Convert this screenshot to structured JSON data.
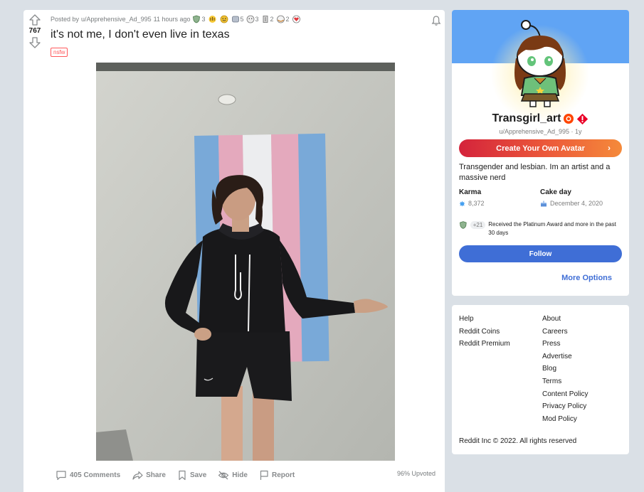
{
  "post": {
    "score": "767",
    "posted_by_prefix": "Posted by",
    "author": "u/Apprehensive_Ad_995",
    "time": "11 hours ago",
    "awards": [
      {
        "icon": "shield-award-icon",
        "count": "3"
      },
      {
        "icon": "hands-award-icon",
        "count": ""
      },
      {
        "icon": "wholesome-award-icon",
        "count": ""
      },
      {
        "icon": "helpful-award-icon",
        "count": "5"
      },
      {
        "icon": "gold-award-icon",
        "count": "3"
      },
      {
        "icon": "silver-award-icon",
        "count": "2"
      },
      {
        "icon": "hug-award-icon",
        "count": "2"
      },
      {
        "icon": "heart-award-icon",
        "count": ""
      }
    ],
    "title": "it's not me, I don't even live in texas",
    "flair": "nsfw",
    "comments_label": "405 Comments",
    "share_label": "Share",
    "save_label": "Save",
    "hide_label": "Hide",
    "report_label": "Report",
    "upvoted": "96% Upvoted"
  },
  "profile": {
    "display_name": "Transgirl_art",
    "subline": "u/Apprehensive_Ad_995 · 1y",
    "create_avatar_label": "Create Your Own Avatar",
    "bio": "Transgender and lesbian. Im an artist and a massive nerd",
    "karma_label": "Karma",
    "karma_value": "8,372",
    "cake_label": "Cake day",
    "cake_value": "December 4, 2020",
    "trophy_plus": "+21",
    "trophy_text": "Received the Platinum Award and more in the past 30 days",
    "follow_label": "Follow",
    "more_options_label": "More Options"
  },
  "links": {
    "left": [
      "Help",
      "Reddit Coins",
      "Reddit Premium"
    ],
    "right": [
      "About",
      "Careers",
      "Press",
      "Advertise",
      "Blog",
      "Terms",
      "Content Policy",
      "Privacy Policy",
      "Mod Policy"
    ],
    "copyright": "Reddit Inc © 2022. All rights reserved"
  },
  "colors": {
    "accent_blue": "#3f6ed6",
    "banner": "#60a4f4",
    "nsfw": "#ff585b",
    "page_bg": "#dae0e6"
  }
}
